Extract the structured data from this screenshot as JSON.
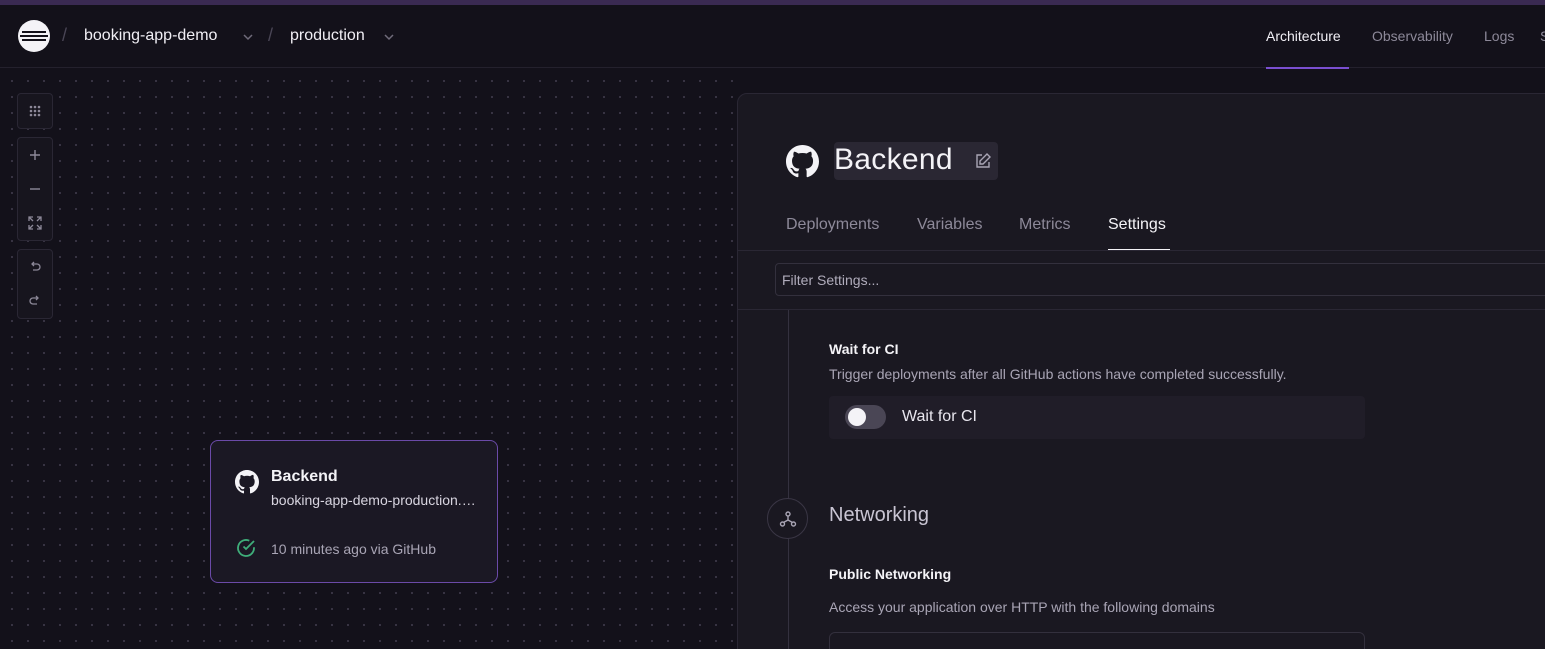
{
  "header": {
    "project": "booking-app-demo",
    "environment": "production",
    "separator": "/",
    "tabs": [
      {
        "label": "Architecture",
        "active": true
      },
      {
        "label": "Observability",
        "active": false
      },
      {
        "label": "Logs",
        "active": false
      },
      {
        "label": "S",
        "active": false
      }
    ]
  },
  "canvas": {
    "service_card": {
      "title": "Backend",
      "subtitle": "booking-app-demo-production.up.railway.app",
      "status": "10 minutes ago via GitHub"
    }
  },
  "panel": {
    "title": "Backend",
    "tabs": [
      "Deployments",
      "Variables",
      "Metrics",
      "Settings"
    ],
    "active_tab": "Settings",
    "filter_placeholder": "Filter Settings...",
    "wait_for_ci": {
      "label": "Wait for CI",
      "description": "Trigger deployments after all GitHub actions have completed successfully.",
      "toggle_label": "Wait for CI",
      "enabled": false
    },
    "networking": {
      "title": "Networking",
      "public_label": "Public Networking",
      "public_desc": "Access your application over HTTP with the following domains"
    }
  },
  "colors": {
    "accent": "#7a4fd0",
    "background": "#13111a",
    "panel": "#1a1821",
    "success": "#3fae7a"
  }
}
